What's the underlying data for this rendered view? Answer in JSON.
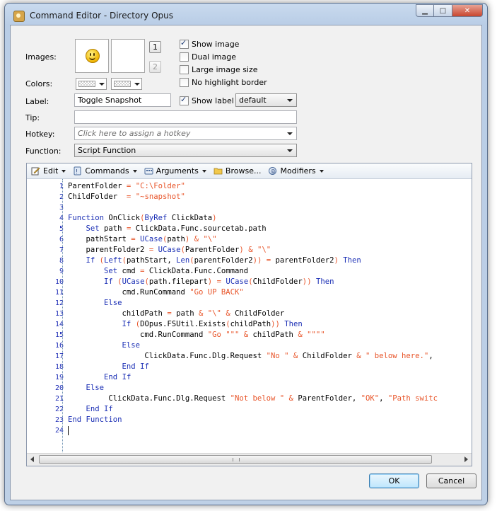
{
  "window": {
    "title": "Command Editor - Directory Opus",
    "minimize_glyph": "▁",
    "maximize_glyph": "□",
    "close_glyph": "✕"
  },
  "form": {
    "images_label": "Images:",
    "colors_label": "Colors:",
    "label_label": "Label:",
    "label_value": "Toggle Snapshot",
    "tip_label": "Tip:",
    "tip_value": "",
    "hotkey_label": "Hotkey:",
    "hotkey_placeholder": "Click here to assign a hotkey",
    "function_label": "Function:",
    "function_value": "Script Function",
    "image_slot_1": "1",
    "image_slot_2": "2",
    "show_image": {
      "label": "Show image",
      "checked": true
    },
    "dual_image": {
      "label": "Dual image",
      "checked": false
    },
    "large_image_size": {
      "label": "Large image size",
      "checked": false
    },
    "no_highlight_border": {
      "label": "No highlight border",
      "checked": false
    },
    "show_label": {
      "label": "Show label",
      "checked": true
    },
    "label_style": "default"
  },
  "toolbar": {
    "edit": "Edit",
    "commands": "Commands",
    "arguments": "Arguments",
    "browse": "Browse...",
    "modifiers": "Modifiers"
  },
  "code_lines": [
    "ParentFolder = \"C:\\Folder\"",
    "ChildFolder  = \"~snapshot\"",
    "",
    "Function OnClick(ByRef ClickData)",
    "    Set path = ClickData.Func.sourcetab.path",
    "    pathStart = UCase(path) & \"\\\"",
    "    parentFolder2 = UCase(ParentFolder) & \"\\\"",
    "    If (Left(pathStart, Len(parentFolder2)) = parentFolder2) Then",
    "        Set cmd = ClickData.Func.Command",
    "        If (UCase(path.filepart) = UCase(ChildFolder)) Then",
    "            cmd.RunCommand \"Go UP BACK\"",
    "        Else",
    "            childPath = path & \"\\\" & ChildFolder",
    "            If (DOpus.FSUtil.Exists(childPath)) Then",
    "                cmd.RunCommand \"Go \"\"\" & childPath & \"\"\"\"",
    "            Else",
    "                 ClickData.Func.Dlg.Request \"No \" & ChildFolder & \" below here.\",",
    "            End If",
    "        End If",
    "    Else",
    "         ClickData.Func.Dlg.Request \"Not below \" & ParentFolder, \"OK\", \"Path switc",
    "    End If",
    "End Function",
    ""
  ],
  "buttons": {
    "ok": "OK",
    "cancel": "Cancel"
  }
}
